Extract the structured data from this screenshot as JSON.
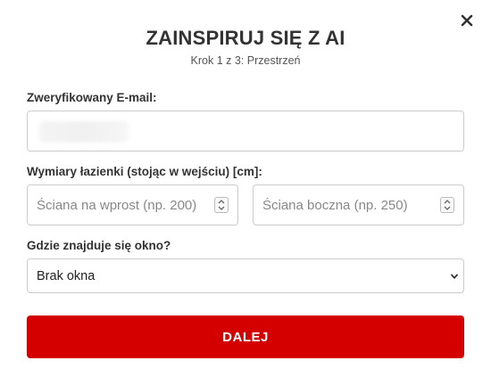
{
  "modal": {
    "title": "ZAINSPIRUJ SIĘ Z AI",
    "step": "Krok 1 z 3: Przestrzeń",
    "close_icon": "close-icon"
  },
  "form": {
    "email": {
      "label": "Zweryfikowany E-mail:",
      "value": ""
    },
    "dimensions": {
      "label": "Wymiary łazienki (stojąc w wejściu) [cm]:",
      "front_wall_placeholder": "Ściana na wprost (np. 200)",
      "side_wall_placeholder": "Ściana boczna (np. 250)"
    },
    "window": {
      "label": "Gdzie znajduje się okno?",
      "selected": "Brak okna"
    },
    "next_label": "DALEJ"
  },
  "colors": {
    "accent": "#d40000",
    "border": "#cccccc",
    "title": "#333333"
  }
}
